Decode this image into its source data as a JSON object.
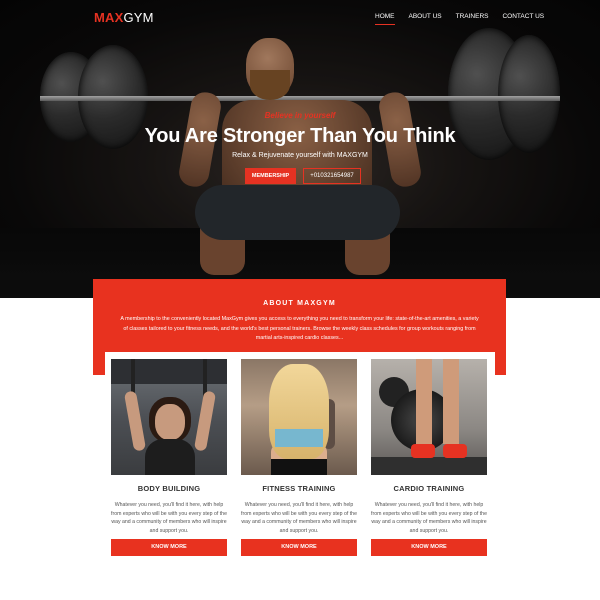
{
  "brand": {
    "logo_max": "MAX",
    "logo_gym": "GYM",
    "accent": "#e63222"
  },
  "nav": {
    "items": [
      {
        "label": "HOME",
        "active": true
      },
      {
        "label": "ABOUT US",
        "active": false
      },
      {
        "label": "TRAINERS",
        "active": false
      },
      {
        "label": "CONTACT US",
        "active": false
      }
    ]
  },
  "hero": {
    "tagline": "Believe in yourself",
    "headline": "You Are Stronger Than You Think",
    "subline": "Relax & Rejuvenate yourself with MAXGYM",
    "primary_button": "MEMBERSHIP",
    "secondary_button": "+01032165498​7"
  },
  "about": {
    "title": "ABOUT MAXGYM",
    "text": "A membership to the conveniently located MaxGym gives you access to everything you need to transform your life: state-of-the-art amenities, a variety of classes tailored to your fitness needs, and the world's best personal trainers. Browse the weekly class schedules for group workouts ranging from martial arts-inspired cardio classes..."
  },
  "cards": [
    {
      "title": "BODY BUILDING",
      "desc": "Whatever you need, you'll find it here, with help from experts who will be with you every step of the way and a community of members who will inspire and support you.",
      "button": "KNOW MORE"
    },
    {
      "title": "FITNESS TRAINING",
      "desc": "Whatever you need, you'll find it here, with help from experts who will be with you every step of the way and a community of members who will inspire and support you.",
      "button": "KNOW MORE"
    },
    {
      "title": "CARDIO TRAINING",
      "desc": "Whatever you need, you'll find it here, with help from experts who will be with you every step of the way and a community of members who will inspire and support you.",
      "button": "KNOW MORE"
    }
  ]
}
